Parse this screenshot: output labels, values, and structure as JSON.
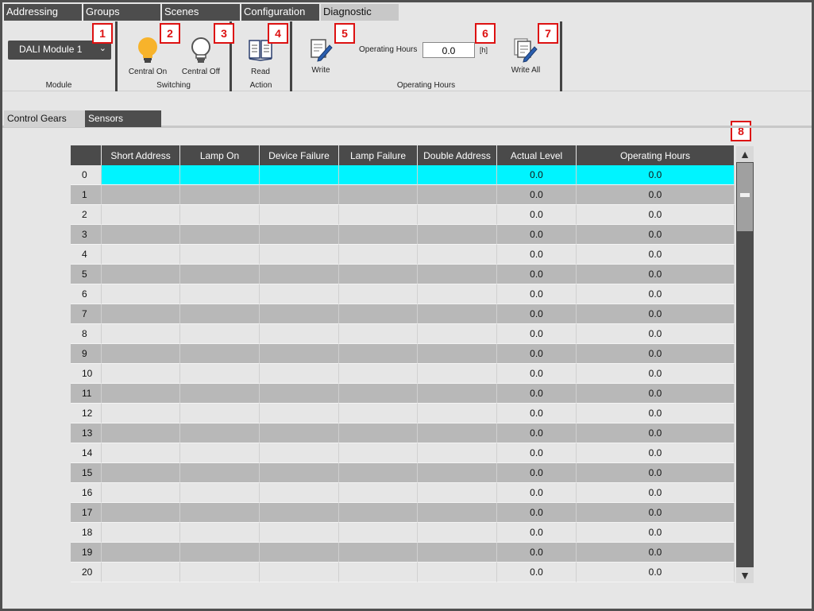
{
  "top_tabs": [
    {
      "label": "Addressing"
    },
    {
      "label": "Groups"
    },
    {
      "label": "Scenes"
    },
    {
      "label": "Configuration"
    },
    {
      "label": "Diagnostic",
      "active": true
    }
  ],
  "ribbon": {
    "module": {
      "selected": "DALI Module 1",
      "group_label": "Module"
    },
    "switching": {
      "central_on": "Central On",
      "central_off": "Central Off",
      "group_label": "Switching"
    },
    "action": {
      "read": "Read",
      "group_label": "Action"
    },
    "operating_hours": {
      "write": "Write",
      "label": "Operating Hours",
      "value": "0.0",
      "unit": "[h]",
      "write_all": "Write All",
      "group_label": "Operating Hours"
    }
  },
  "markers": [
    "1",
    "2",
    "3",
    "4",
    "5",
    "6",
    "7",
    "8"
  ],
  "sub_tabs": [
    {
      "label": "Control Gears",
      "active": true
    },
    {
      "label": "Sensors"
    }
  ],
  "table": {
    "columns": [
      "",
      "Short Address",
      "Lamp On",
      "Device Failure",
      "Lamp Failure",
      "Double Address",
      "Actual Level",
      "Operating Hours"
    ],
    "selected_row": 0,
    "rows": [
      {
        "index": "0",
        "actual_level": "0.0",
        "operating_hours": "0.0"
      },
      {
        "index": "1",
        "actual_level": "0.0",
        "operating_hours": "0.0"
      },
      {
        "index": "2",
        "actual_level": "0.0",
        "operating_hours": "0.0"
      },
      {
        "index": "3",
        "actual_level": "0.0",
        "operating_hours": "0.0"
      },
      {
        "index": "4",
        "actual_level": "0.0",
        "operating_hours": "0.0"
      },
      {
        "index": "5",
        "actual_level": "0.0",
        "operating_hours": "0.0"
      },
      {
        "index": "6",
        "actual_level": "0.0",
        "operating_hours": "0.0"
      },
      {
        "index": "7",
        "actual_level": "0.0",
        "operating_hours": "0.0"
      },
      {
        "index": "8",
        "actual_level": "0.0",
        "operating_hours": "0.0"
      },
      {
        "index": "9",
        "actual_level": "0.0",
        "operating_hours": "0.0"
      },
      {
        "index": "10",
        "actual_level": "0.0",
        "operating_hours": "0.0"
      },
      {
        "index": "11",
        "actual_level": "0.0",
        "operating_hours": "0.0"
      },
      {
        "index": "12",
        "actual_level": "0.0",
        "operating_hours": "0.0"
      },
      {
        "index": "13",
        "actual_level": "0.0",
        "operating_hours": "0.0"
      },
      {
        "index": "14",
        "actual_level": "0.0",
        "operating_hours": "0.0"
      },
      {
        "index": "15",
        "actual_level": "0.0",
        "operating_hours": "0.0"
      },
      {
        "index": "16",
        "actual_level": "0.0",
        "operating_hours": "0.0"
      },
      {
        "index": "17",
        "actual_level": "0.0",
        "operating_hours": "0.0"
      },
      {
        "index": "18",
        "actual_level": "0.0",
        "operating_hours": "0.0"
      },
      {
        "index": "19",
        "actual_level": "0.0",
        "operating_hours": "0.0"
      },
      {
        "index": "20",
        "actual_level": "0.0",
        "operating_hours": "0.0"
      }
    ]
  },
  "colors": {
    "selected_row": "#00f4ff",
    "tab_dark": "#4d4d4d",
    "marker": "#dd1111",
    "bulb_on": "#f7b32b"
  }
}
